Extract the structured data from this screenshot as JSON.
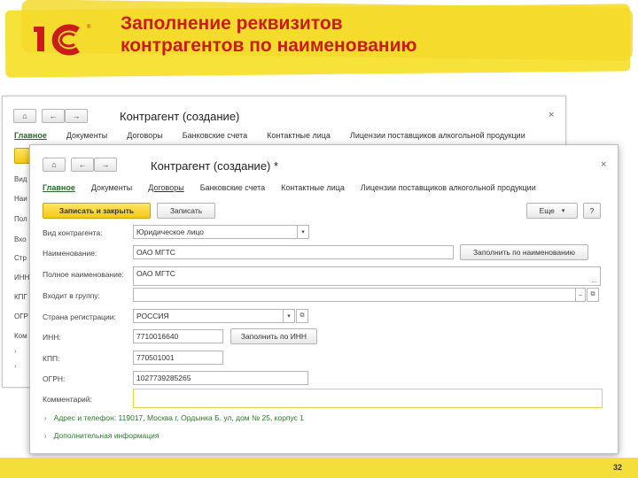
{
  "slide": {
    "title_line1": "Заполнение реквизитов",
    "title_line2": "контрагентов по наименованию",
    "page_number": "32",
    "brand_color": "#cc1b1b",
    "accent_color": "#f5c913"
  },
  "back_window": {
    "title": "Контрагент (создание)",
    "close": "×",
    "tabs": [
      "Главное",
      "Документы",
      "Договоры",
      "Банковские счета",
      "Контактные лица",
      "Лицензии поставщиков алкогольной продукции"
    ],
    "side_labels": [
      "Вид",
      "Наи",
      "Пол",
      "Вхо",
      "Стр",
      "ИНН",
      "КПГ",
      "ОГР",
      "Ком"
    ]
  },
  "front_window": {
    "title": "Контрагент (создание) *",
    "close": "×",
    "tabs": [
      "Главное",
      "Документы",
      "Договоры",
      "Банковские счета",
      "Контактные лица",
      "Лицензии поставщиков алкогольной продукции"
    ],
    "toolbar": {
      "save_close": "Записать и закрыть",
      "save": "Записать",
      "more": "Еще",
      "help": "?"
    },
    "fields": {
      "kind_label": "Вид контрагента:",
      "kind_value": "Юридическое лицо",
      "name_label": "Наименование:",
      "name_value": "ОАО МГТС",
      "fill_by_name": "Заполнить по наименованию",
      "full_name_label": "Полное наименование:",
      "full_name_value": "ОАО МГТС",
      "group_label": "Входит в группу:",
      "country_label": "Страна регистрации:",
      "country_value": "РОССИЯ",
      "inn_label": "ИНН:",
      "inn_value": "7710016640",
      "fill_by_inn": "Заполнить по ИНН",
      "kpp_label": "КПП:",
      "kpp_value": "770501001",
      "ogrn_label": "ОГРН:",
      "ogrn_value": "1027739285265",
      "comment_label": "Комментарий:"
    },
    "links": {
      "address": "Адрес и телефон: 119017, Москва г, Ордынка Б. ул, дом № 25, корпус 1",
      "extra": "Дополнительная информация"
    }
  }
}
